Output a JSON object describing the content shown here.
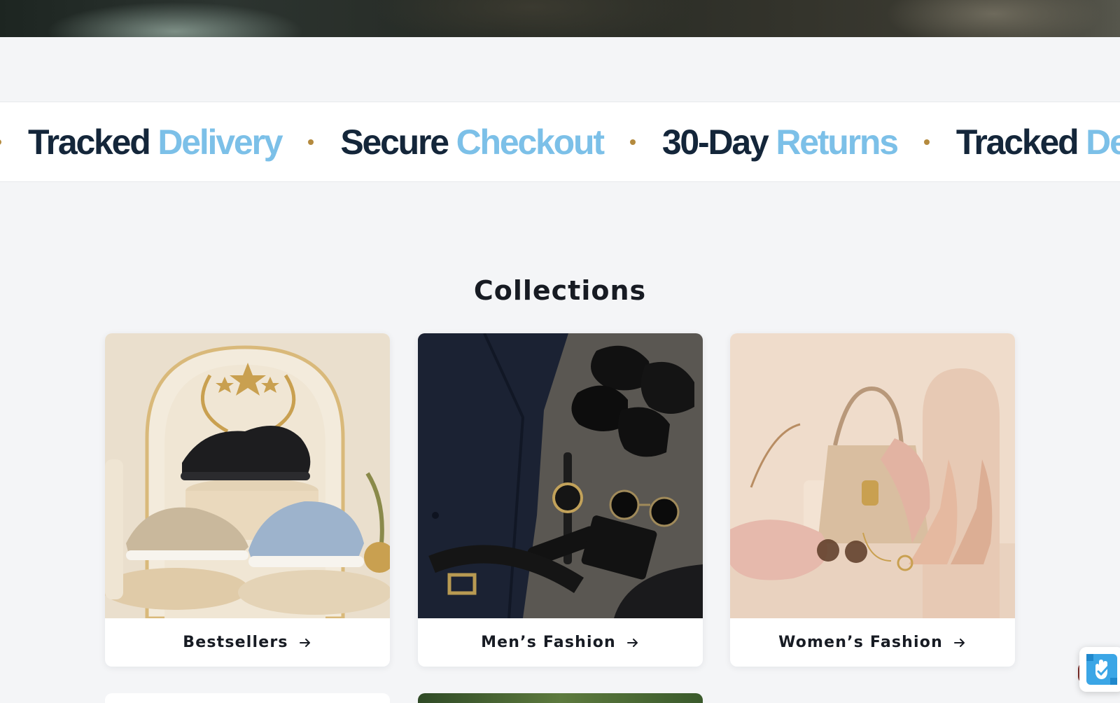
{
  "marquee": {
    "items": [
      {
        "word1": "Tracked",
        "word2": "Delivery"
      },
      {
        "word1": "Secure",
        "word2": "Checkout"
      },
      {
        "word1": "30-Day",
        "word2": "Returns"
      },
      {
        "word1": "Tracked",
        "word2": "Delivery"
      }
    ],
    "colors": {
      "primary": "#14263a",
      "accent": "#7cc0e8",
      "dot": "#b48a3e"
    }
  },
  "collections": {
    "title": "Collections",
    "cards": [
      {
        "label": "Bestsellers",
        "icon": "arrow-right-icon"
      },
      {
        "label": "Men’s Fashion",
        "icon": "arrow-right-icon"
      },
      {
        "label": "Women’s Fashion",
        "icon": "arrow-right-icon"
      }
    ]
  },
  "widget": {
    "icon": "accessibility-hand-icon"
  }
}
